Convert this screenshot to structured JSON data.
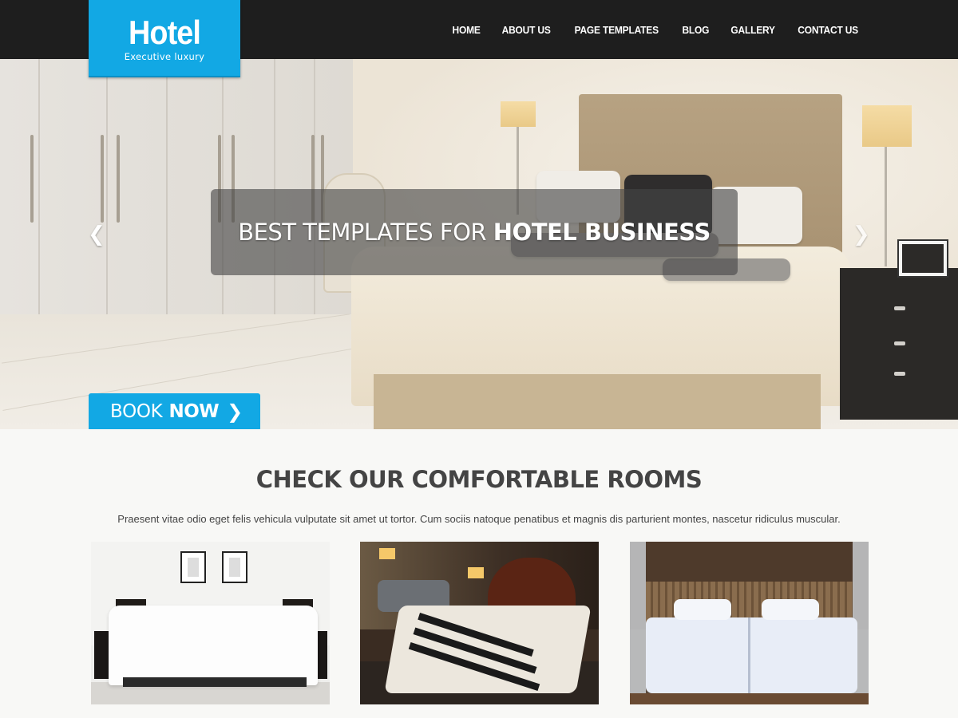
{
  "brand": {
    "title": "Hotel",
    "tagline": "Executive luxury",
    "accent_color": "#12a8e4",
    "header_color": "#1e1e1e"
  },
  "nav": {
    "items": [
      {
        "label": "HOME"
      },
      {
        "label": "ABOUT US"
      },
      {
        "label": "PAGE TEMPLATES"
      },
      {
        "label": "BLOG"
      },
      {
        "label": "GALLERY"
      },
      {
        "label": "CONTACT US"
      }
    ]
  },
  "hero": {
    "caption_light": "BEST TEMPLATES FOR ",
    "caption_bold": "HOTEL BUSINESS",
    "prev_icon": "chevron-left-icon",
    "next_icon": "chevron-right-icon",
    "book_light": "BOOK",
    "book_bold": "NOW",
    "book_icon": "chevron-right-icon"
  },
  "rooms": {
    "title_light": "CHECK OUR COMFORTABLE ",
    "title_bold": "ROOMS",
    "description": "Praesent vitae odio eget felis vehicula vulputate sit amet ut tortor. Cum sociis natoque penatibus et magnis dis parturient montes, nascetur ridiculus muscular."
  }
}
